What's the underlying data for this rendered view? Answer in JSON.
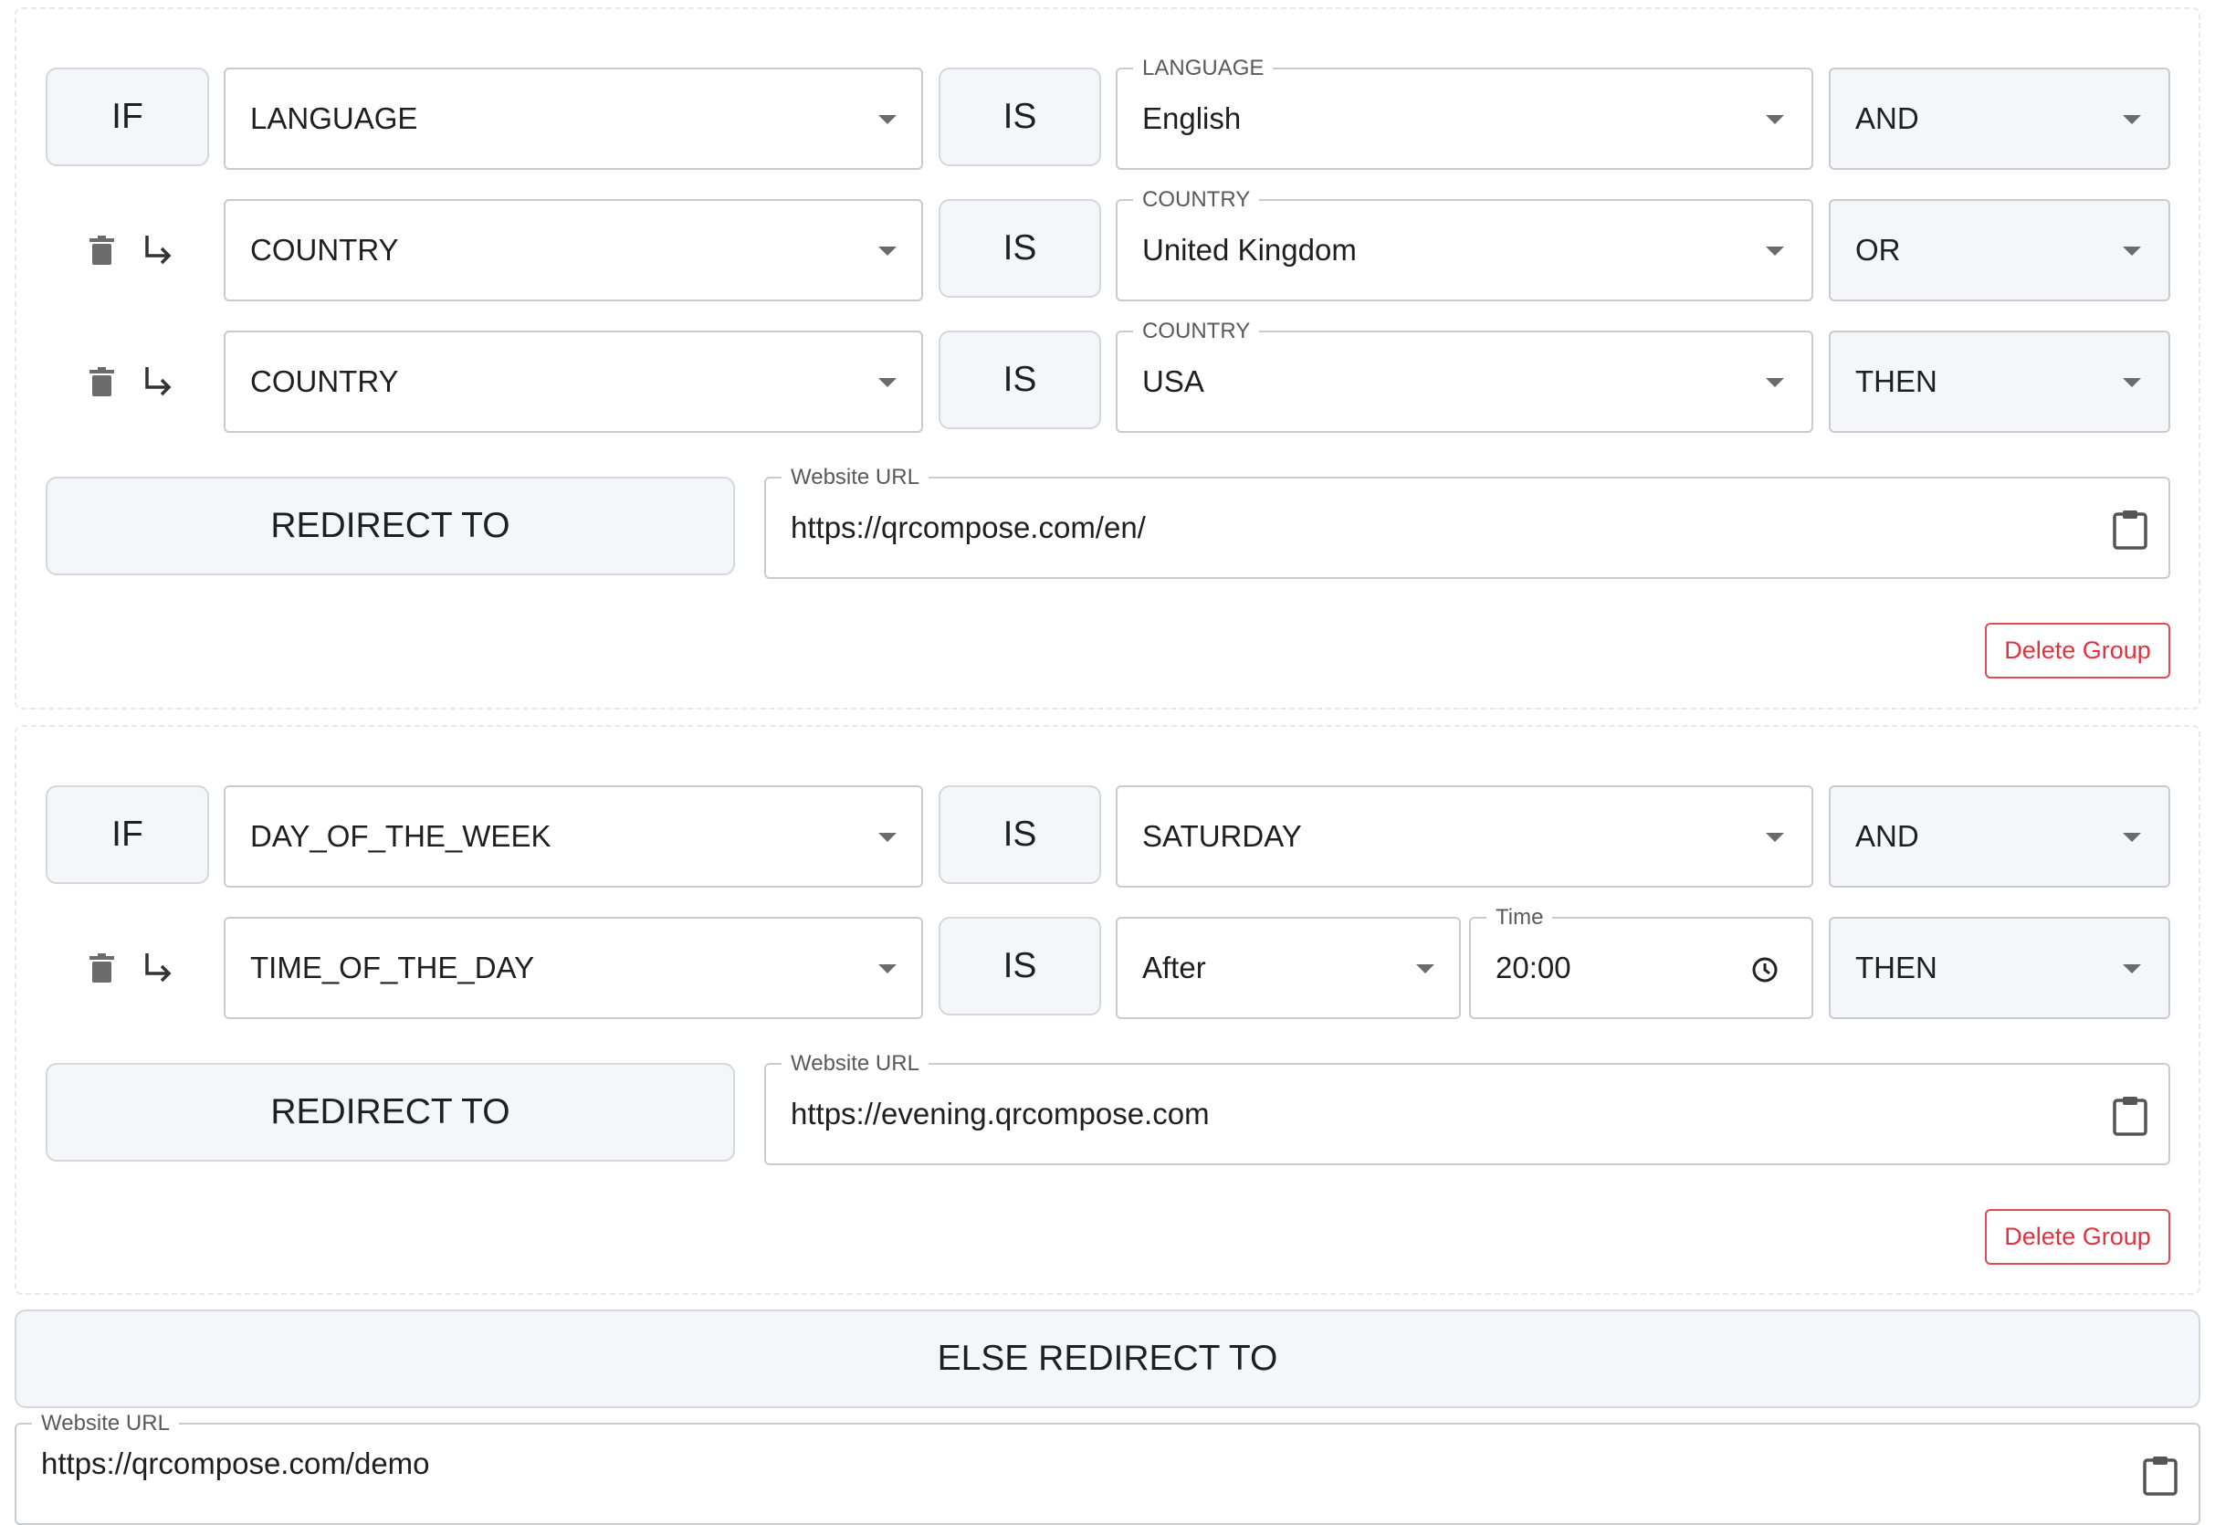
{
  "group1": {
    "if_label": "IF",
    "rows": [
      {
        "field": "LANGUAGE",
        "op": "IS",
        "value_label": "LANGUAGE",
        "value": "English",
        "connector": "AND"
      },
      {
        "field": "COUNTRY",
        "op": "IS",
        "value_label": "COUNTRY",
        "value": "United Kingdom",
        "connector": "OR"
      },
      {
        "field": "COUNTRY",
        "op": "IS",
        "value_label": "COUNTRY",
        "value": "USA",
        "connector": "THEN"
      }
    ],
    "redirect_label": "REDIRECT TO",
    "url_label": "Website URL",
    "url_value": "https://qrcompose.com/en/",
    "delete_group": "Delete Group"
  },
  "group2": {
    "if_label": "IF",
    "rows": [
      {
        "field": "DAY_OF_THE_WEEK",
        "op": "IS",
        "value": "SATURDAY",
        "connector": "AND"
      },
      {
        "field": "TIME_OF_THE_DAY",
        "op": "IS",
        "comparator": "After",
        "time_label": "Time",
        "time_value": "20:00",
        "connector": "THEN"
      }
    ],
    "redirect_label": "REDIRECT TO",
    "url_label": "Website URL",
    "url_value": "https://evening.qrcompose.com",
    "delete_group": "Delete Group"
  },
  "else": {
    "label": "ELSE REDIRECT TO",
    "url_label": "Website URL",
    "url_value": "https://qrcompose.com/demo"
  },
  "colors": {
    "danger": "#e03340",
    "grey_fill": "#f5f6f9",
    "border": "#c9cbd0",
    "icon": "#6b6b6b"
  },
  "icons": [
    "trash-icon",
    "subdirectory-arrow-icon",
    "dropdown-arrow-icon",
    "clipboard-icon",
    "clock-icon"
  ]
}
